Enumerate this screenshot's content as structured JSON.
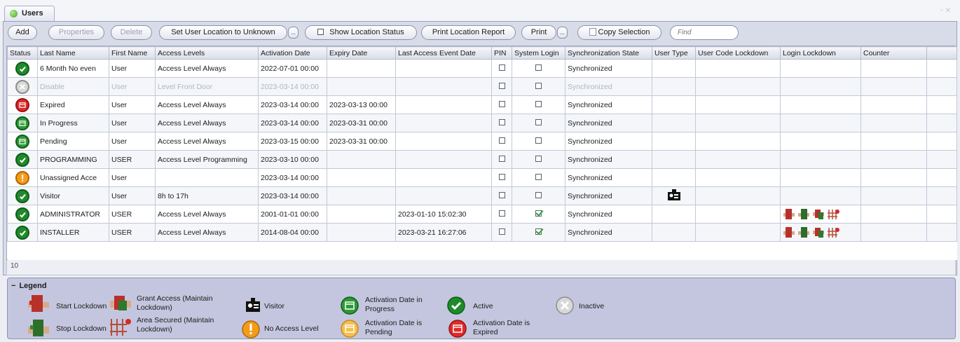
{
  "tab": {
    "title": "Users"
  },
  "toolbar": {
    "add": "Add",
    "properties": "Properties",
    "delete": "Delete",
    "set_location": "Set User Location to Unknown",
    "more": "...",
    "show_location_status": "Show Location Status",
    "print_location_report": "Print Location Report",
    "print": "Print",
    "copy_selection": "Copy Selection",
    "find_placeholder": "Find"
  },
  "grid": {
    "columns": [
      "Status",
      "Last Name",
      "First Name",
      "Access Levels",
      "Activation Date",
      "Expiry Date",
      "Last Access Event Date",
      "PIN",
      "System Login",
      "Synchronization State",
      "User Type",
      "User Code Lockdown",
      "Login Lockdown",
      "Counter",
      ""
    ],
    "rows": [
      {
        "status": "active",
        "last": "6 Month No even",
        "first": "User",
        "access": "Access Level Always",
        "activation": "2022-07-01 00:00",
        "expiry": "",
        "last_event": "",
        "pin": false,
        "login": false,
        "sync": "Synchronized",
        "user_type": "",
        "lockdown": false
      },
      {
        "status": "inactive",
        "last": "Disable",
        "first": "User",
        "access": "Level Front Door",
        "activation": "2023-03-14 00:00",
        "expiry": "",
        "last_event": "",
        "pin": false,
        "login": false,
        "sync": "Synchronized",
        "user_type": "",
        "lockdown": false
      },
      {
        "status": "expired",
        "last": "Expired",
        "first": "User",
        "access": "Access Level Always",
        "activation": "2023-03-14 00:00",
        "expiry": "2023-03-13 00:00",
        "last_event": "",
        "pin": false,
        "login": false,
        "sync": "Synchronized",
        "user_type": "",
        "lockdown": false
      },
      {
        "status": "progress",
        "last": "In Progress",
        "first": "User",
        "access": "Access Level Always",
        "activation": "2023-03-14 00:00",
        "expiry": "2023-03-31 00:00",
        "last_event": "",
        "pin": false,
        "login": false,
        "sync": "Synchronized",
        "user_type": "",
        "lockdown": false
      },
      {
        "status": "progress",
        "last": "Pending",
        "first": "User",
        "access": "Access Level Always",
        "activation": "2023-03-15 00:00",
        "expiry": "2023-03-31 00:00",
        "last_event": "",
        "pin": false,
        "login": false,
        "sync": "Synchronized",
        "user_type": "",
        "lockdown": false
      },
      {
        "status": "active",
        "last": "PROGRAMMING",
        "first": "USER",
        "access": "Access Level Programming",
        "activation": "2023-03-10 00:00",
        "expiry": "",
        "last_event": "",
        "pin": false,
        "login": false,
        "sync": "Synchronized",
        "user_type": "",
        "lockdown": false
      },
      {
        "status": "noaccess",
        "last": "Unassigned Acce",
        "first": "User",
        "access": "",
        "activation": "2023-03-14 00:00",
        "expiry": "",
        "last_event": "",
        "pin": false,
        "login": false,
        "sync": "Synchronized",
        "user_type": "",
        "lockdown": false
      },
      {
        "status": "active",
        "last": "Visitor",
        "first": "User",
        "access": "8h to 17h",
        "activation": "2023-03-14 00:00",
        "expiry": "",
        "last_event": "",
        "pin": false,
        "login": false,
        "sync": "Synchronized",
        "user_type": "visitor",
        "lockdown": false
      },
      {
        "status": "active",
        "last": "ADMINISTRATOR",
        "first": "USER",
        "access": "Access Level Always",
        "activation": "2001-01-01 00:00",
        "expiry": "",
        "last_event": "2023-01-10 15:02:30",
        "pin": false,
        "login": true,
        "sync": "Synchronized",
        "user_type": "",
        "lockdown": true
      },
      {
        "status": "active",
        "last": "INSTALLER",
        "first": "USER",
        "access": "Access Level Always",
        "activation": "2014-08-04 00:00",
        "expiry": "",
        "last_event": "2023-03-21 16:27:06",
        "pin": false,
        "login": true,
        "sync": "Synchronized",
        "user_type": "",
        "lockdown": true
      }
    ]
  },
  "row_count": "10",
  "legend": {
    "title": "Legend",
    "items": {
      "start_lockdown": "Start Lockdown",
      "stop_lockdown": "Stop Lockdown",
      "grant_access": "Grant Access (Maintain Lockdown)",
      "area_secured": "Area Secured (Maintain Lockdown)",
      "visitor": "Visitor",
      "no_access": "No Access Level",
      "activation_progress": "Activation Date in Progress",
      "activation_pending": "Activation Date is Pending",
      "active": "Active",
      "activation_expired": "Activation Date is Expired",
      "inactive": "Inactive"
    }
  },
  "colors": {
    "active": "#1f8a2b",
    "inactive": "#d8d8d8",
    "expired": "#e02a2a",
    "progress": "#2d9936",
    "noaccess": "#f39c1a",
    "pending": "#f5bf4f",
    "legend_bg": "#c3c6de"
  }
}
